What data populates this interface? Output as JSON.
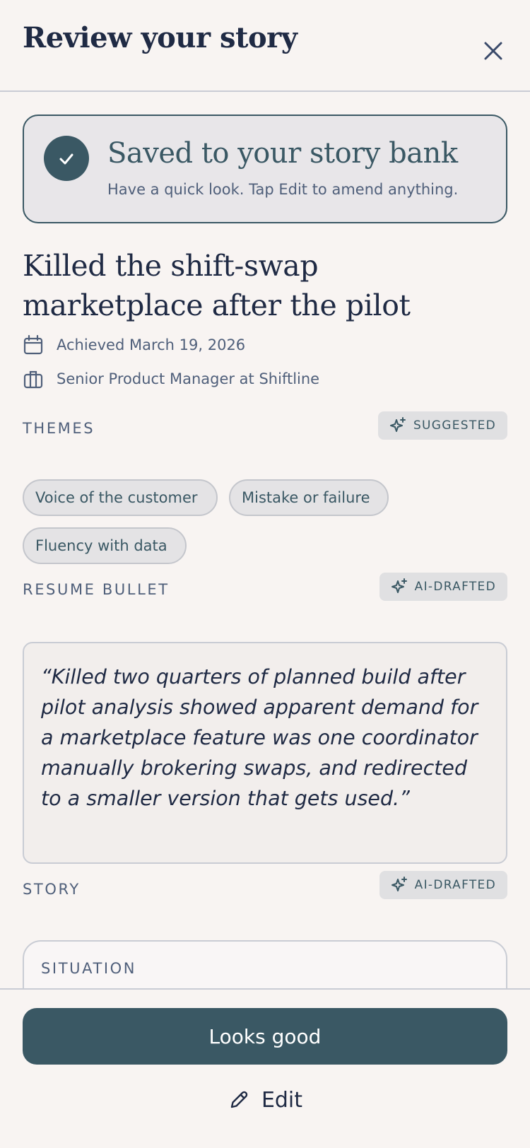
{
  "header": {
    "title": "Review your story",
    "close_icon": "close-icon"
  },
  "saved_banner": {
    "title": "Saved to your story bank",
    "subtitle": "Have a quick look. Tap Edit to amend anything.",
    "icon": "check-icon"
  },
  "story": {
    "title": "Killed the shift-swap marketplace after the pilot",
    "achieved": "Achieved March 19, 2026",
    "role": "Senior Product Manager at Shiftline"
  },
  "themes": {
    "label": "THEMES",
    "badge": "SUGGESTED",
    "chips": [
      "Voice of the customer",
      "Mistake or failure",
      "Fluency with data"
    ]
  },
  "resume_bullet": {
    "label": "RESUME BULLET",
    "badge": "AI-DRAFTED",
    "text": "“Killed two quarters of planned build after pilot analysis showed apparent demand for a marketplace feature was one coordinator manually brokering swaps, and redirected to a smaller version that gets used.”"
  },
  "story_section": {
    "label": "STORY",
    "badge": "AI-DRAFTED",
    "situation_label": "SITUATION"
  },
  "footer": {
    "primary_label": "Looks good",
    "edit_label": "Edit"
  },
  "colors": {
    "accent": "#3a5864",
    "background": "#f8f4f2",
    "text": "#1f2a44",
    "muted": "#4f5f7a"
  }
}
